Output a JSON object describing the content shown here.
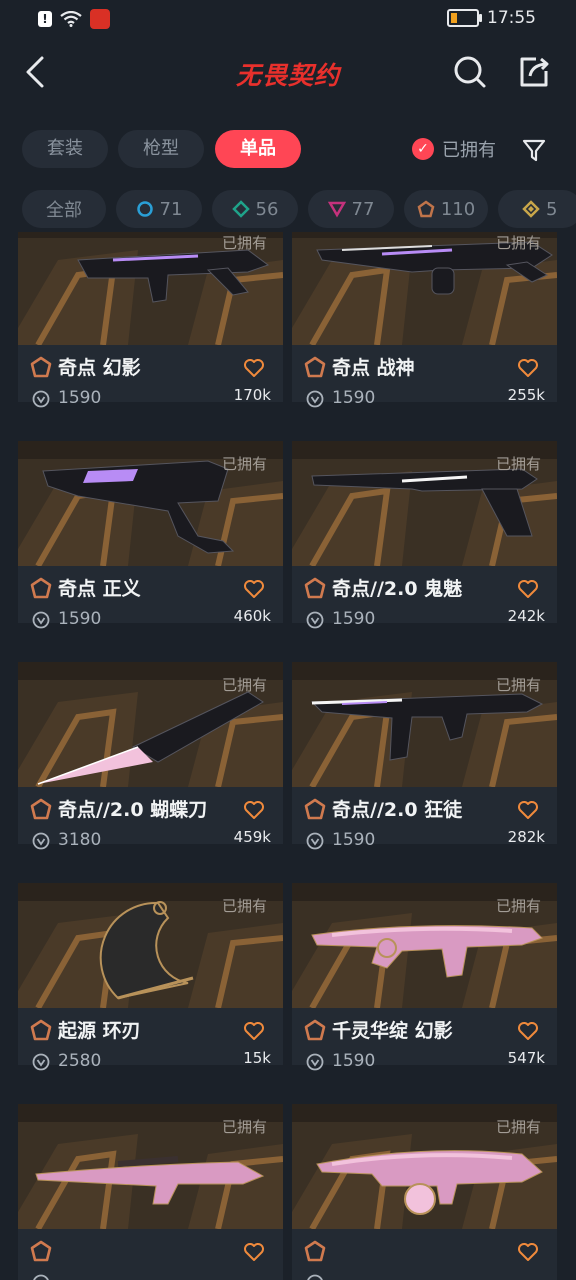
{
  "status_bar": {
    "time": "17:55"
  },
  "header": {
    "title": "无畏契约"
  },
  "tabs": [
    {
      "label": "套装",
      "active": false
    },
    {
      "label": "枪型",
      "active": false
    },
    {
      "label": "单品",
      "active": true
    }
  ],
  "owned_filter": {
    "label": "已拥有",
    "checked": true
  },
  "tier_chips": [
    {
      "label": "全部",
      "icon": ""
    },
    {
      "label": "71",
      "icon": "select-tier-icon",
      "color": "#2a9fd6"
    },
    {
      "label": "56",
      "icon": "deluxe-tier-icon",
      "color": "#1fa38a"
    },
    {
      "label": "77",
      "icon": "premium-tier-icon",
      "color": "#c5327d"
    },
    {
      "label": "110",
      "icon": "exclusive-tier-icon",
      "color": "#c0744a"
    },
    {
      "label": "5",
      "icon": "ultra-tier-icon",
      "color": "#c8a64a"
    }
  ],
  "owned_label": "已拥有",
  "items": [
    {
      "name": "奇点 幻影",
      "price": "1590",
      "likes": "170k",
      "weapon": "rifle-dark"
    },
    {
      "name": "奇点 战神",
      "price": "1590",
      "likes": "255k",
      "weapon": "lmg-dark"
    },
    {
      "name": "奇点 正义",
      "price": "1590",
      "likes": "460k",
      "weapon": "revolver-dark"
    },
    {
      "name": "奇点//2.0 鬼魅",
      "price": "1590",
      "likes": "242k",
      "weapon": "pistol-dark"
    },
    {
      "name": "奇点//2.0 蝴蝶刀",
      "price": "3180",
      "likes": "459k",
      "weapon": "knife-dark"
    },
    {
      "name": "奇点//2.0 狂徒",
      "price": "1590",
      "likes": "282k",
      "weapon": "rifle2-dark"
    },
    {
      "name": "起源 环刃",
      "price": "2580",
      "likes": "15k",
      "weapon": "ring-blade"
    },
    {
      "name": "千灵华绽 幻影",
      "price": "1590",
      "likes": "547k",
      "weapon": "rifle-pink"
    },
    {
      "name": "",
      "price": "",
      "likes": "",
      "weapon": "sniper-pink"
    },
    {
      "name": "",
      "price": "",
      "likes": "",
      "weapon": "smg-pink"
    }
  ]
}
